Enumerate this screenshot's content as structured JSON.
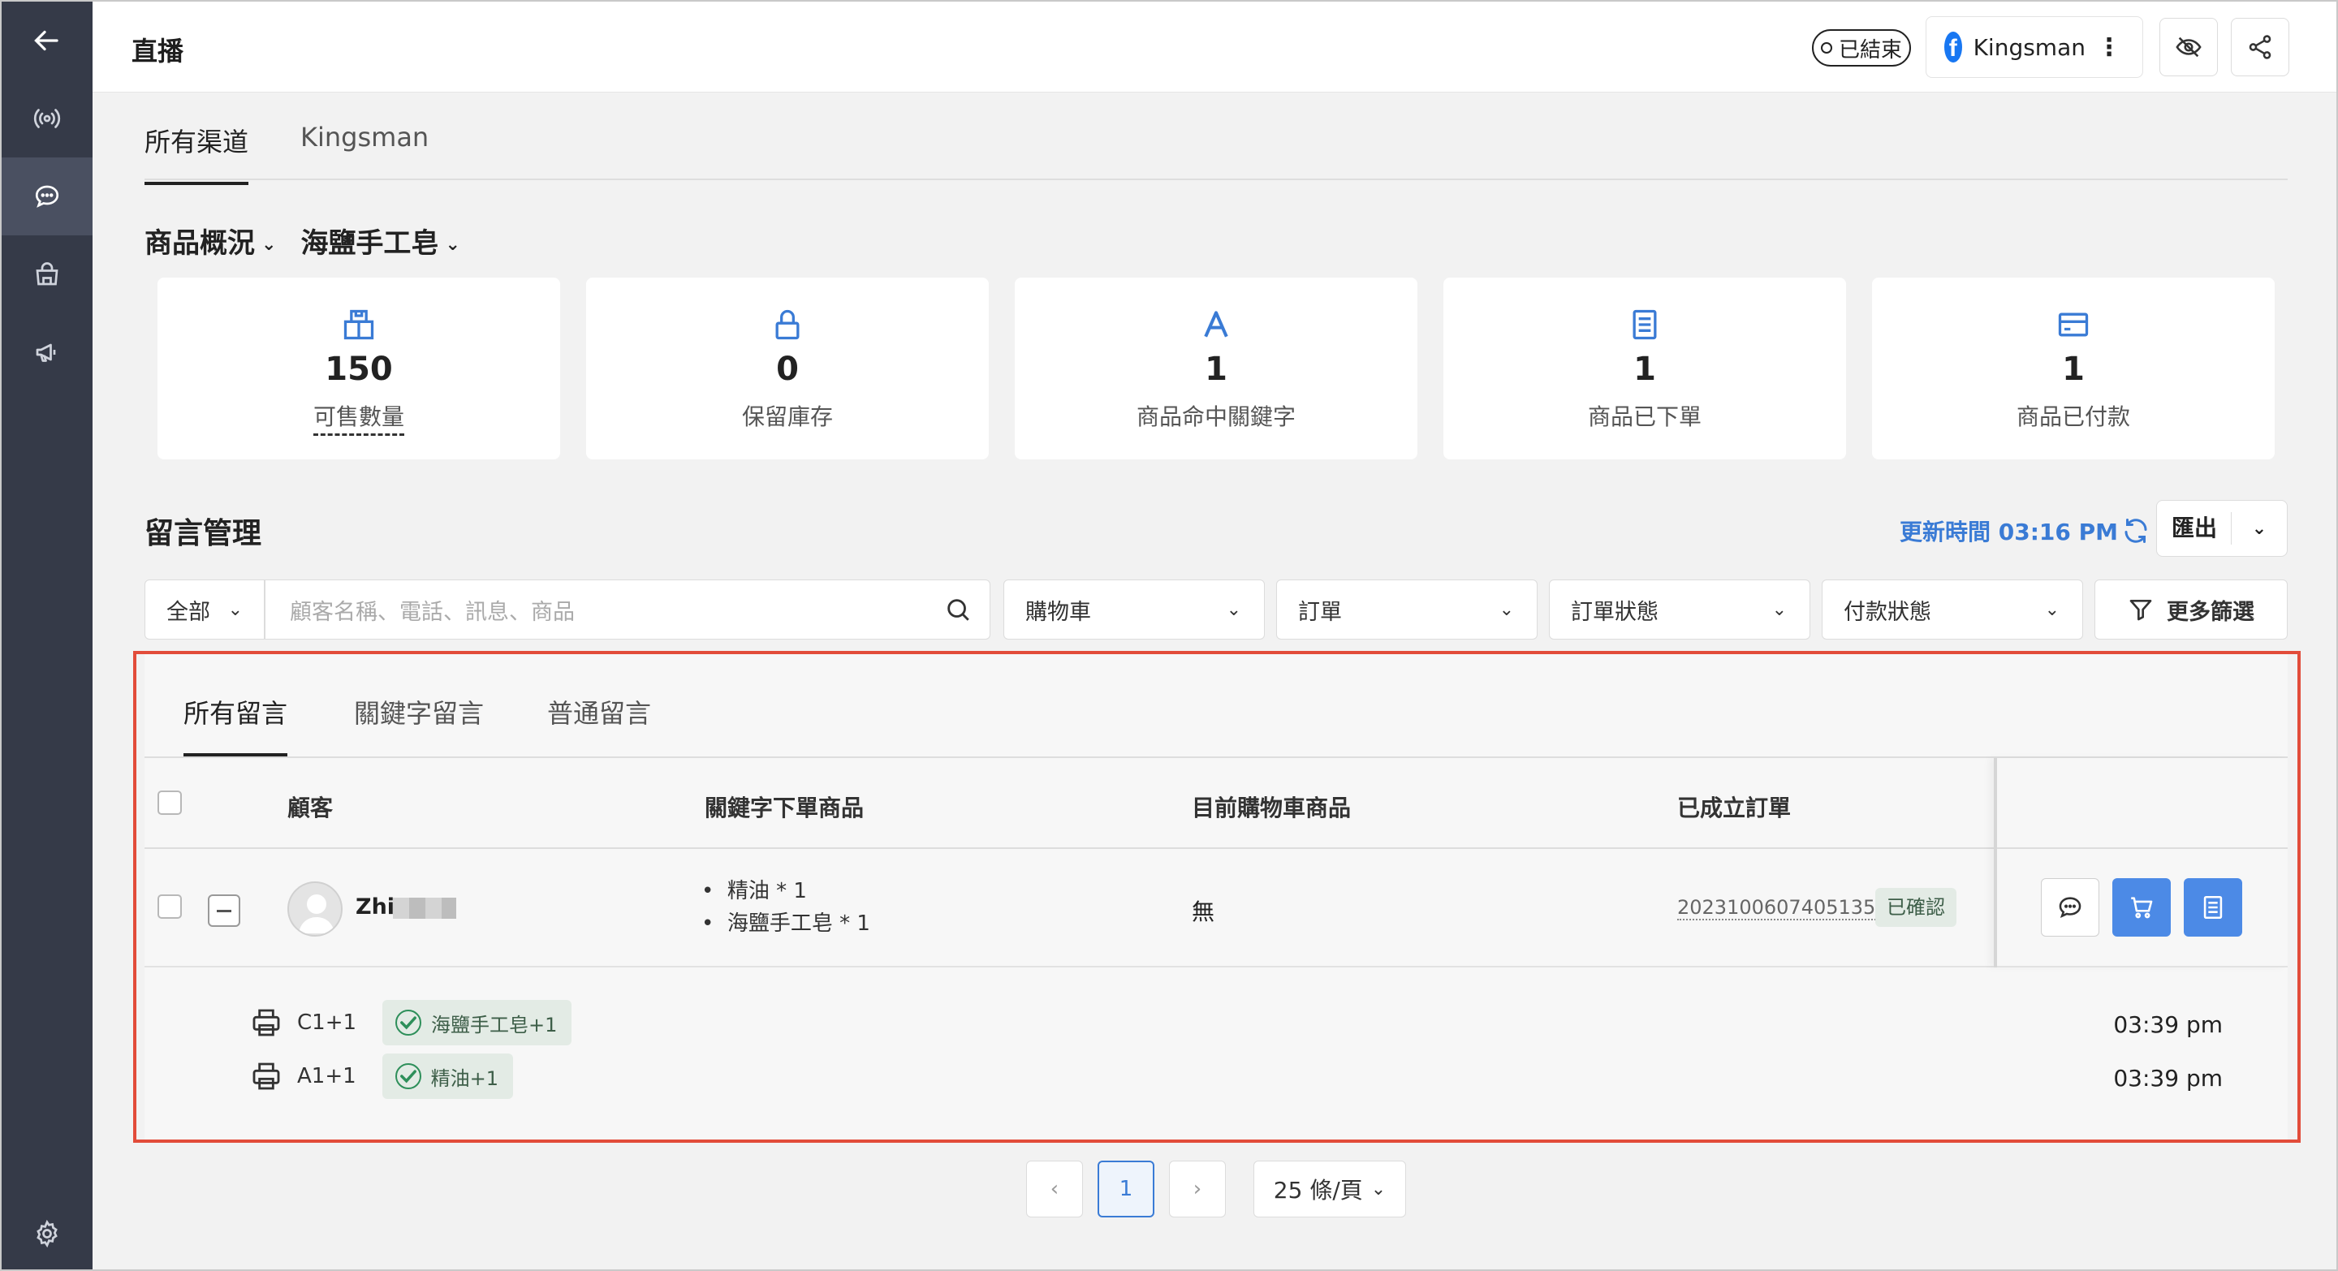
{
  "header": {
    "title": "直播",
    "status": "已結束",
    "channel": "Kingsman"
  },
  "channel_tabs": [
    "所有渠道",
    "Kingsman"
  ],
  "product_overview": {
    "label": "商品概況",
    "product": "海鹽手工皂",
    "stats": [
      {
        "value": "150",
        "label": "可售數量",
        "icon": "box-icon"
      },
      {
        "value": "0",
        "label": "保留庫存",
        "icon": "lock-icon"
      },
      {
        "value": "1",
        "label": "商品命中關鍵字",
        "icon": "keyword-icon"
      },
      {
        "value": "1",
        "label": "商品已下單",
        "icon": "order-icon"
      },
      {
        "value": "1",
        "label": "商品已付款",
        "icon": "card-icon"
      }
    ]
  },
  "comments": {
    "title": "留言管理",
    "update_time": "更新時間 03:16 PM",
    "export_label": "匯出",
    "filters": {
      "scope": "全部",
      "search_placeholder": "顧客名稱、電話、訊息、商品",
      "cart": "購物車",
      "order": "訂單",
      "order_status": "訂單狀態",
      "payment_status": "付款狀態",
      "more": "更多篩選"
    },
    "tabs": [
      "所有留言",
      "關鍵字留言",
      "普通留言"
    ],
    "columns": [
      "顧客",
      "關鍵字下單商品",
      "目前購物車商品",
      "已成立訂單"
    ],
    "row": {
      "customer": "Zhi",
      "keyword_items": [
        "精油  * 1",
        "海鹽手工皂  * 1"
      ],
      "cart": "無",
      "order_no": "20231006074051359",
      "order_status": "已確認"
    },
    "sub_comments": [
      {
        "text": "C1+1",
        "badge": "海鹽手工皂+1",
        "time": "03:39 pm"
      },
      {
        "text": "A1+1",
        "badge": "精油+1",
        "time": "03:39 pm"
      }
    ]
  },
  "pagination": {
    "page": "1",
    "page_size": "25 條/頁"
  },
  "colors": {
    "sidebar": "#353a48",
    "accent": "#3a7bd5",
    "action_blue": "#4c8ae6",
    "highlight": "#e24c3a",
    "badge_bg": "#e3ebe5"
  }
}
